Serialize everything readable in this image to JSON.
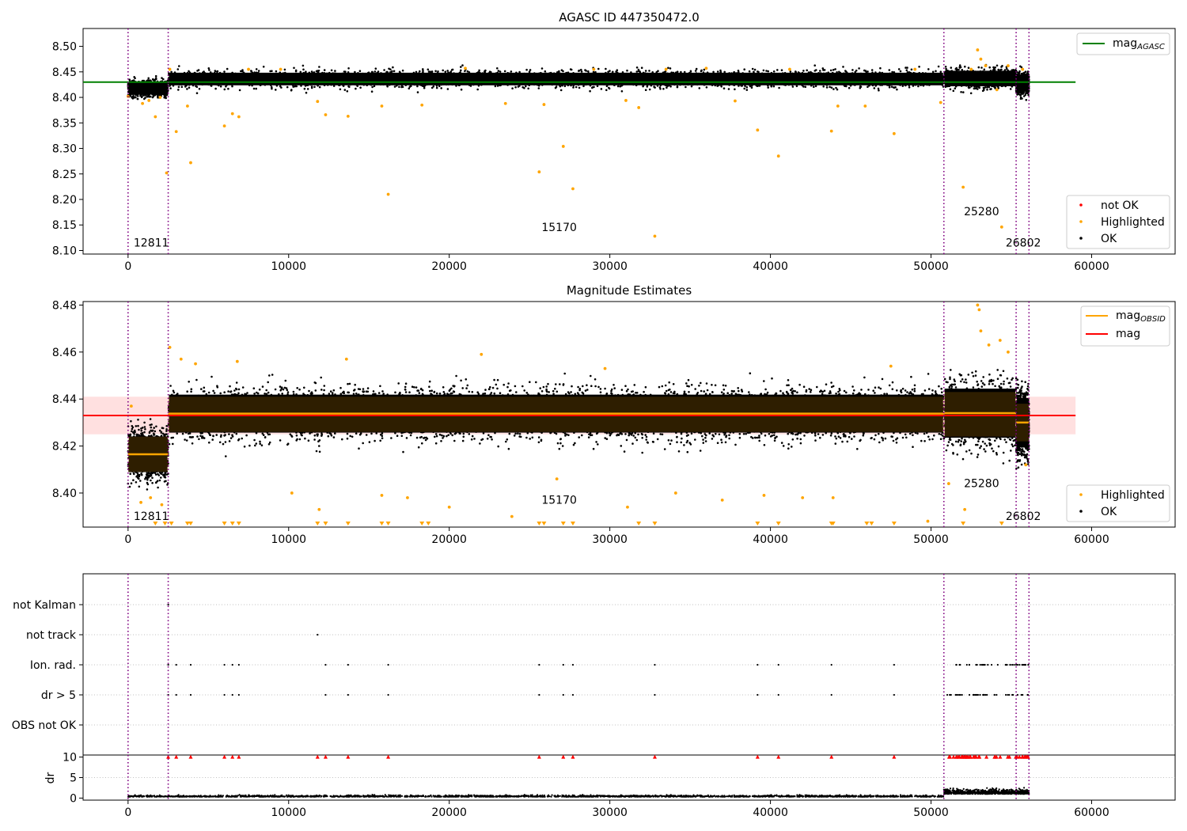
{
  "chart_data": [
    {
      "type": "scatter",
      "title": "AGASC ID 447350472.0",
      "x_range": [
        -2800,
        65200
      ],
      "y_range": [
        8.093,
        8.535
      ],
      "x_ticks": [
        0,
        10000,
        20000,
        30000,
        40000,
        50000,
        60000
      ],
      "x_tick_labels": [
        "0",
        "10000",
        "20000",
        "30000",
        "40000",
        "50000",
        "60000"
      ],
      "y_ticks": [
        8.1,
        8.15,
        8.2,
        8.25,
        8.3,
        8.35,
        8.4,
        8.45,
        8.5
      ],
      "y_tick_labels": [
        "8.10",
        "8.15",
        "8.20",
        "8.25",
        "8.30",
        "8.35",
        "8.40",
        "8.45",
        "8.50"
      ],
      "obsid_boundaries": [
        0,
        2500,
        50800,
        55300,
        56100
      ],
      "annotations": [
        {
          "text": "12811",
          "x": 200,
          "y": 8.108
        },
        {
          "text": "15170",
          "x": 25600,
          "y": 8.138
        },
        {
          "text": "25280",
          "x": 51900,
          "y": 8.169
        },
        {
          "text": "26802",
          "x": 54500,
          "y": 8.108
        }
      ],
      "reference_line": {
        "label": "mag",
        "sub": "AGASC",
        "y": 8.43,
        "x_range": [
          -2800,
          59000
        ],
        "color": "#008000"
      },
      "ok_bands": [
        {
          "x": [
            0,
            2500
          ],
          "center": 8.418,
          "spread": 0.013
        },
        {
          "x": [
            2500,
            50800
          ],
          "center": 8.436,
          "spread": 0.013
        },
        {
          "x": [
            50800,
            55300
          ],
          "center": 8.437,
          "spread": 0.016
        },
        {
          "x": [
            55300,
            56100
          ],
          "center": 8.428,
          "spread": 0.016
        }
      ],
      "highlighted": [
        [
          0,
          8.402
        ],
        [
          900,
          8.388
        ],
        [
          1300,
          8.394
        ],
        [
          1700,
          8.362
        ],
        [
          2000,
          8.4
        ],
        [
          2400,
          8.252
        ],
        [
          2600,
          8.455
        ],
        [
          3000,
          8.333
        ],
        [
          3700,
          8.383
        ],
        [
          3900,
          8.272
        ],
        [
          6000,
          8.344
        ],
        [
          6500,
          8.368
        ],
        [
          6900,
          8.362
        ],
        [
          7500,
          8.455
        ],
        [
          9500,
          8.455
        ],
        [
          11800,
          8.392
        ],
        [
          12300,
          8.366
        ],
        [
          13700,
          8.363
        ],
        [
          15800,
          8.383
        ],
        [
          16200,
          8.21
        ],
        [
          18300,
          8.385
        ],
        [
          21000,
          8.457
        ],
        [
          23500,
          8.388
        ],
        [
          25600,
          8.254
        ],
        [
          25900,
          8.386
        ],
        [
          27100,
          8.304
        ],
        [
          27700,
          8.221
        ],
        [
          29000,
          8.455
        ],
        [
          31000,
          8.394
        ],
        [
          31800,
          8.38
        ],
        [
          32800,
          8.128
        ],
        [
          33500,
          8.455
        ],
        [
          36000,
          8.457
        ],
        [
          37800,
          8.393
        ],
        [
          39200,
          8.336
        ],
        [
          40500,
          8.285
        ],
        [
          41200,
          8.455
        ],
        [
          43800,
          8.334
        ],
        [
          44200,
          8.383
        ],
        [
          45900,
          8.383
        ],
        [
          47700,
          8.329
        ],
        [
          49000,
          8.455
        ],
        [
          50600,
          8.39
        ],
        [
          52000,
          8.224
        ],
        [
          52500,
          8.455
        ],
        [
          52900,
          8.493
        ],
        [
          53100,
          8.475
        ],
        [
          53400,
          8.462
        ],
        [
          54100,
          8.415
        ],
        [
          54400,
          8.146
        ],
        [
          54800,
          8.462
        ],
        [
          55700,
          8.455
        ]
      ],
      "legend_top": [
        {
          "name": "mag",
          "sub": "AGASC",
          "color": "#008000",
          "marker": "line"
        }
      ],
      "legend_bottom": [
        {
          "name": "not OK",
          "color": "#ff0000",
          "marker": "dot"
        },
        {
          "name": "Highlighted",
          "color": "#ffa500",
          "marker": "dot"
        },
        {
          "name": "OK",
          "color": "#000000",
          "marker": "dot"
        }
      ]
    },
    {
      "type": "scatter",
      "title": "Magnitude Estimates",
      "x_range": [
        -2800,
        65200
      ],
      "y_range": [
        8.3855,
        8.4815
      ],
      "x_ticks": [
        0,
        10000,
        20000,
        30000,
        40000,
        50000,
        60000
      ],
      "x_tick_labels": [
        "0",
        "10000",
        "20000",
        "30000",
        "40000",
        "50000",
        "60000"
      ],
      "y_ticks": [
        8.4,
        8.42,
        8.44,
        8.46,
        8.48
      ],
      "y_tick_labels": [
        "8.40",
        "8.42",
        "8.44",
        "8.46",
        "8.48"
      ],
      "obsid_boundaries": [
        0,
        2500,
        50800,
        55300,
        56100
      ],
      "annotations": [
        {
          "text": "12811",
          "x": 200,
          "y": 8.3885
        },
        {
          "text": "15170",
          "x": 25600,
          "y": 8.3955
        },
        {
          "text": "25280",
          "x": 51900,
          "y": 8.4025
        },
        {
          "text": "26802",
          "x": 54500,
          "y": 8.3885
        }
      ],
      "mag_line": {
        "label": "mag",
        "y": 8.433,
        "band": [
          8.425,
          8.441
        ],
        "x_range": [
          -2800,
          59000
        ],
        "color": "#ff0000"
      },
      "obsid_means": [
        {
          "x": [
            0,
            2500
          ],
          "y": 8.4165,
          "band": [
            8.409,
            8.424
          ]
        },
        {
          "x": [
            2500,
            50800
          ],
          "y": 8.4338,
          "band": [
            8.426,
            8.441
          ]
        },
        {
          "x": [
            50800,
            55300
          ],
          "y": 8.434,
          "band": [
            8.424,
            8.443
          ]
        },
        {
          "x": [
            55300,
            56100
          ],
          "y": 8.43,
          "band": [
            8.422,
            8.438
          ]
        }
      ],
      "ok_bands": [
        {
          "x": [
            0,
            2500
          ],
          "center": 8.4165,
          "spread": 0.008
        },
        {
          "x": [
            2500,
            50800
          ],
          "center": 8.4338,
          "spread": 0.0085
        },
        {
          "x": [
            50800,
            55300
          ],
          "center": 8.434,
          "spread": 0.011
        },
        {
          "x": [
            55300,
            56100
          ],
          "center": 8.43,
          "spread": 0.011
        }
      ],
      "highlighted": [
        [
          200,
          8.437
        ],
        [
          800,
          8.396
        ],
        [
          1400,
          8.398
        ],
        [
          2100,
          8.395
        ],
        [
          2600,
          8.462
        ],
        [
          3300,
          8.457
        ],
        [
          4200,
          8.455
        ],
        [
          6800,
          8.456
        ],
        [
          10200,
          8.4
        ],
        [
          11900,
          8.393
        ],
        [
          13600,
          8.457
        ],
        [
          15800,
          8.399
        ],
        [
          17400,
          8.398
        ],
        [
          20000,
          8.394
        ],
        [
          22000,
          8.459
        ],
        [
          23900,
          8.39
        ],
        [
          26700,
          8.406
        ],
        [
          29700,
          8.453
        ],
        [
          31100,
          8.394
        ],
        [
          34100,
          8.4
        ],
        [
          37000,
          8.397
        ],
        [
          39600,
          8.399
        ],
        [
          42000,
          8.398
        ],
        [
          43900,
          8.398
        ],
        [
          47500,
          8.454
        ],
        [
          49800,
          8.388
        ],
        [
          51100,
          8.404
        ],
        [
          52100,
          8.393
        ],
        [
          52900,
          8.48
        ],
        [
          53000,
          8.478
        ],
        [
          53100,
          8.469
        ],
        [
          53600,
          8.463
        ],
        [
          54300,
          8.465
        ],
        [
          54800,
          8.46
        ],
        [
          55900,
          8.412
        ]
      ],
      "clipped_low_x": [
        1700,
        2300,
        2700,
        3700,
        3900,
        6000,
        6500,
        6900,
        11800,
        12300,
        13700,
        15800,
        16200,
        18300,
        18700,
        25600,
        25900,
        27100,
        27700,
        31800,
        32800,
        39200,
        40500,
        43800,
        43900,
        46000,
        46300,
        47700,
        52000,
        54400
      ],
      "legend_top": [
        {
          "name": "mag",
          "sub": "OBSID",
          "color": "#ffa500",
          "marker": "line"
        },
        {
          "name": "mag",
          "sub": "",
          "color": "#ff0000",
          "marker": "line"
        }
      ],
      "legend_bottom": [
        {
          "name": "Highlighted",
          "color": "#ffa500",
          "marker": "dot"
        },
        {
          "name": "OK",
          "color": "#000000",
          "marker": "dot"
        }
      ]
    },
    {
      "type": "scatter",
      "title": "",
      "x_range": [
        -2800,
        65200
      ],
      "categories": [
        "not Kalman",
        "not track",
        "Ion. rad.",
        "dr > 5",
        "OBS not OK"
      ],
      "obsid_boundaries": [
        0,
        2500,
        50800,
        55300,
        56100
      ],
      "flags": {
        "not Kalman": [
          2500
        ],
        "not track": [
          11800
        ],
        "Ion. rad.": [
          2500,
          3000,
          3900,
          6000,
          6500,
          6900,
          12300,
          13700,
          16200,
          25600,
          27100,
          27700,
          32800,
          39200,
          40500,
          43800,
          47700
        ],
        "dr > 5": [
          2500,
          3000,
          3900,
          6000,
          6500,
          6900,
          12300,
          13700,
          16200,
          25600,
          27100,
          27700,
          32800,
          39200,
          40500,
          43800,
          47700
        ],
        "OBS not OK": []
      },
      "flag_clusters": {
        "Ion. rad.": [
          51000,
          56100
        ],
        "dr > 5": [
          51000,
          56100
        ]
      }
    },
    {
      "type": "scatter",
      "title": "",
      "ylabel": "dr",
      "x_range": [
        -2800,
        65200
      ],
      "y_range": [
        -0.5,
        10.5
      ],
      "y_ticks": [
        0,
        5,
        10
      ],
      "y_tick_labels": [
        "0",
        "5",
        "10"
      ],
      "x_ticks": [
        0,
        10000,
        20000,
        30000,
        40000,
        50000,
        60000
      ],
      "x_tick_labels": [
        "0",
        "10000",
        "20000",
        "30000",
        "40000",
        "50000",
        "60000"
      ],
      "obsid_boundaries": [
        0,
        2500,
        50800,
        55300,
        56100
      ],
      "capped_markers_x": [
        2500,
        3000,
        3900,
        6000,
        6500,
        6900,
        11800,
        12300,
        13700,
        16200,
        25600,
        27100,
        27700,
        32800,
        39200,
        40500,
        43800,
        47700
      ],
      "capped_cluster": [
        51000,
        56100
      ],
      "baseline_bands": [
        {
          "x": [
            0,
            50800
          ],
          "center": 0.3,
          "spread": 0.3
        },
        {
          "x": [
            50800,
            56100
          ],
          "center": 1.0,
          "spread": 0.9
        }
      ]
    }
  ]
}
